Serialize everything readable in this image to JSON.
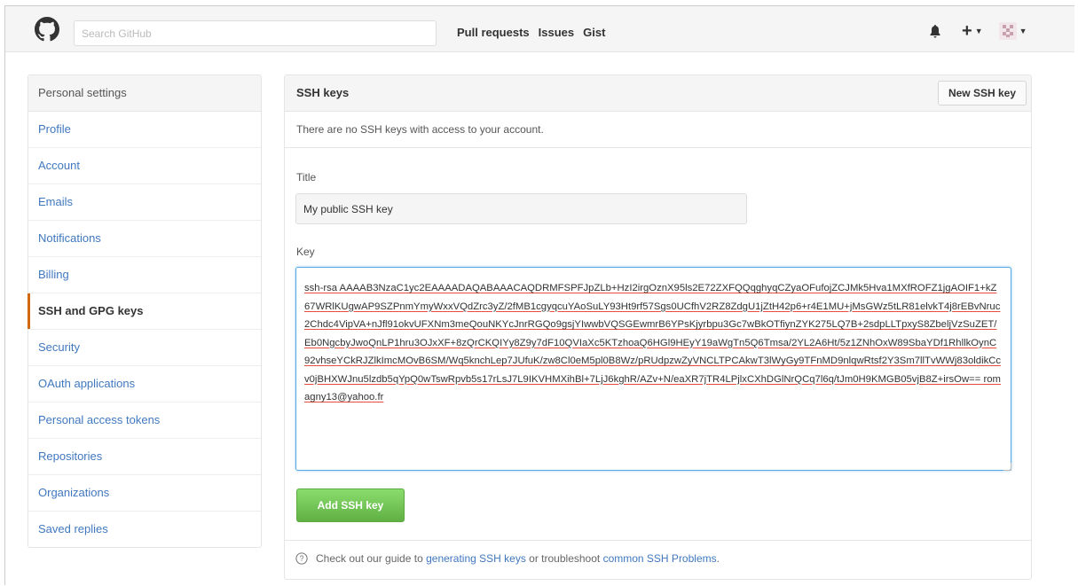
{
  "header": {
    "search_placeholder": "Search GitHub",
    "nav": [
      "Pull requests",
      "Issues",
      "Gist"
    ],
    "icons": [
      "github-logo-icon",
      "bell-icon",
      "plus-icon",
      "avatar"
    ]
  },
  "sidebar": {
    "title": "Personal settings",
    "active": "SSH and GPG keys",
    "items": [
      {
        "label": "Profile"
      },
      {
        "label": "Account"
      },
      {
        "label": "Emails"
      },
      {
        "label": "Notifications"
      },
      {
        "label": "Billing"
      },
      {
        "label": "SSH and GPG keys"
      },
      {
        "label": "Security"
      },
      {
        "label": "OAuth applications"
      },
      {
        "label": "Personal access tokens"
      },
      {
        "label": "Repositories"
      },
      {
        "label": "Organizations"
      },
      {
        "label": "Saved replies"
      }
    ]
  },
  "main": {
    "title": "SSH keys",
    "new_button": "New SSH key",
    "notice": "There are no SSH keys with access to your account.",
    "title_label": "Title",
    "title_value": "My public SSH key",
    "key_label": "Key",
    "key_value": "ssh-rsa AAAAB3NzaC1yc2EAAAADAQABAAACAQDRMFSPFJpZLb+HzI2irgOznX95ls2E72ZXFQQqghyqCZyaOFufojZCJMk5Hva1MXfROFZ1jgAOIF1+kZ67WRlKUgwAP9SZPnmYmyWxxVQdZrc3yZ/2fMB1cgyqcuYAoSuLY93Ht9rf57Sgs0UCfhV2RZ8ZdgU1jZtH42p6+r4E1MU+jMsGWz5tLR81elvkT4j8rEBvNruc2Chdc4VipVA+nJfl91okvUFXNm3meQouNKYcJnrRGQo9gsjYIwwbVQSGEwmrB6YPsKjyrbpu3Gc7wBkOTfiynZYK275LQ7B+2sdpLLTpxyS8ZbeljVzSuZET/Eb0NgcbyJwoQnLP1hru3OJxXF+8zQrCKQIYy8Z9y7dF10QVIaXc5KTzhoaQ6HGl9HEyY19aWgTn5Q6Tmsa/2YL2A6Ht/5z1ZNhOxW89SbaYDf1RhllkOynC92vhseYCkRJZlkImcMOvB6SM/Wq5knchLep7JUfuK/zw8Cl0eM5pl0B8Wz/pRUdpzwZyVNCLTPCAkwT3lWyGy9TFnMD9nlqwRtsf2Y3Sm7llTvWWj83oldikCcv0jBHXWJnu5lzdb5qYpQ0wTswRpvb5s17rLsJ7L9IKVHMXihBl+7LjJ6kghR/AZv+N/eaXR7jTR4LPjlxCXhDGlNrQCq7l6q/tJm0H9KMGB05vjB8Z+irsOw== romagny13@yahoo.fr",
    "add_button": "Add SSH key",
    "footer": {
      "prefix": "Check out our guide to",
      "link1": "generating SSH keys",
      "middle": "or troubleshoot",
      "link2": "common SSH Problems",
      "suffix": "."
    }
  },
  "colors": {
    "link": "#4078c0",
    "active_marker": "#d26911",
    "green_button": "#60b044",
    "focus_border": "#51a7e8"
  }
}
